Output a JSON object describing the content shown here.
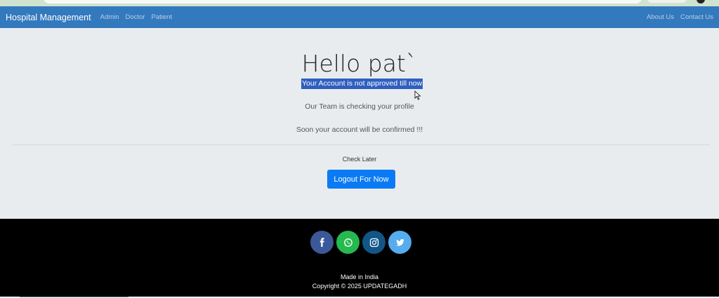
{
  "navbar": {
    "brand": "Hospital Management",
    "left_links": [
      "Admin",
      "Doctor",
      "Patient"
    ],
    "right_links": [
      "About Us",
      "Contact Us"
    ]
  },
  "main": {
    "greeting": "Hello pat`",
    "status_highlight": "Your Account is not approved till now",
    "line_one": "Our Team is checking your profile",
    "line_two": "Soon your account will be confirmed !!!",
    "check_later": "Check Later",
    "logout_label": "Logout For Now"
  },
  "footer": {
    "social_icons": [
      "facebook-icon",
      "whatsapp-icon",
      "instagram-icon",
      "twitter-icon"
    ],
    "made_in": "Made in India",
    "copyright": "Copyright © 2025 UPDATEGADH"
  },
  "colors": {
    "navbar": "#3379bd",
    "button": "#0a7bf5",
    "highlight": "#2f5fbf",
    "facebook": "#3b5998",
    "whatsapp": "#25b94f",
    "instagram": "#125688",
    "twitter": "#55acee"
  }
}
